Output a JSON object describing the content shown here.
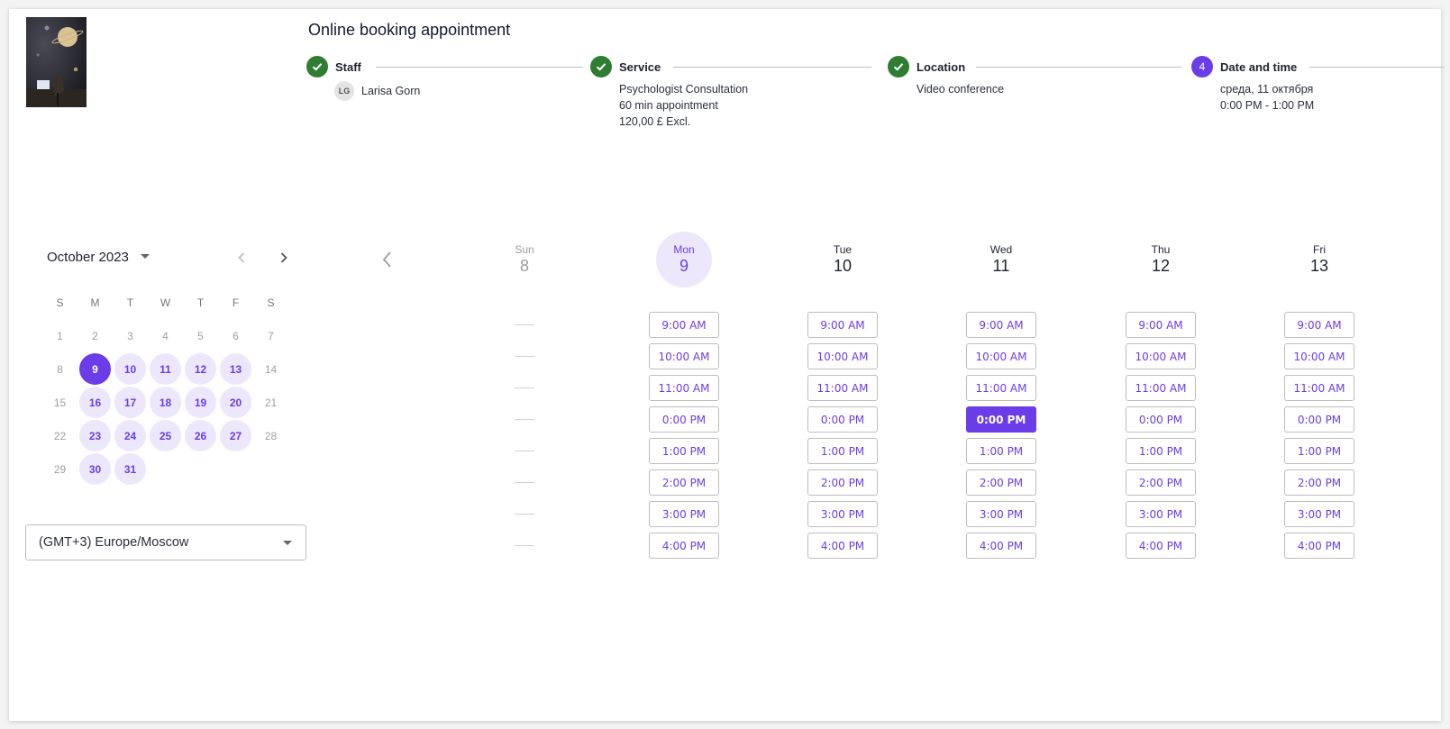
{
  "header": {
    "title": "Online booking appointment",
    "logo_alt": "space-themed logo image"
  },
  "stepper": [
    {
      "label": "Staff",
      "status": "done",
      "icon": "check-icon",
      "staff_initials": "LG",
      "details": [
        "Larisa Gorn"
      ]
    },
    {
      "label": "Service",
      "status": "done",
      "icon": "check-icon",
      "details": [
        "Psychologist Consultation",
        "60 min appointment",
        "120,00 £ Excl."
      ]
    },
    {
      "label": "Location",
      "status": "done",
      "icon": "check-icon",
      "details": [
        "Video conference"
      ]
    },
    {
      "label": "Date and time",
      "status": "active",
      "number": "4",
      "details": [
        "среда, 11 октября",
        "0:00 PM - 1:00 PM"
      ]
    }
  ],
  "calendar": {
    "month_label": "October 2023",
    "weekdays": [
      "S",
      "M",
      "T",
      "W",
      "T",
      "F",
      "S"
    ],
    "days": [
      {
        "n": "1",
        "state": "disabled"
      },
      {
        "n": "2",
        "state": "disabled"
      },
      {
        "n": "3",
        "state": "disabled"
      },
      {
        "n": "4",
        "state": "disabled"
      },
      {
        "n": "5",
        "state": "disabled"
      },
      {
        "n": "6",
        "state": "disabled"
      },
      {
        "n": "7",
        "state": "disabled"
      },
      {
        "n": "8",
        "state": "disabled"
      },
      {
        "n": "9",
        "state": "selected"
      },
      {
        "n": "10",
        "state": "available"
      },
      {
        "n": "11",
        "state": "available"
      },
      {
        "n": "12",
        "state": "available"
      },
      {
        "n": "13",
        "state": "available"
      },
      {
        "n": "14",
        "state": "disabled"
      },
      {
        "n": "15",
        "state": "disabled"
      },
      {
        "n": "16",
        "state": "available"
      },
      {
        "n": "17",
        "state": "available"
      },
      {
        "n": "18",
        "state": "available"
      },
      {
        "n": "19",
        "state": "available"
      },
      {
        "n": "20",
        "state": "available"
      },
      {
        "n": "21",
        "state": "disabled"
      },
      {
        "n": "22",
        "state": "disabled"
      },
      {
        "n": "23",
        "state": "available"
      },
      {
        "n": "24",
        "state": "available"
      },
      {
        "n": "25",
        "state": "available"
      },
      {
        "n": "26",
        "state": "available"
      },
      {
        "n": "27",
        "state": "available"
      },
      {
        "n": "28",
        "state": "disabled"
      },
      {
        "n": "29",
        "state": "disabled"
      },
      {
        "n": "30",
        "state": "available"
      },
      {
        "n": "31",
        "state": "available"
      }
    ]
  },
  "timezone": {
    "value": "(GMT+3) Europe/Moscow"
  },
  "week": {
    "days": [
      {
        "name": "Sun",
        "num": "8",
        "state": "past",
        "slots": []
      },
      {
        "name": "Mon",
        "num": "9",
        "state": "today",
        "slots": [
          "9:00 AM",
          "10:00 AM",
          "11:00 AM",
          "0:00 PM",
          "1:00 PM",
          "2:00 PM",
          "3:00 PM",
          "4:00 PM"
        ]
      },
      {
        "name": "Tue",
        "num": "10",
        "state": "normal",
        "slots": [
          "9:00 AM",
          "10:00 AM",
          "11:00 AM",
          "0:00 PM",
          "1:00 PM",
          "2:00 PM",
          "3:00 PM",
          "4:00 PM"
        ]
      },
      {
        "name": "Wed",
        "num": "11",
        "state": "normal",
        "selected_slot": "0:00 PM",
        "slots": [
          "9:00 AM",
          "10:00 AM",
          "11:00 AM",
          "0:00 PM",
          "1:00 PM",
          "2:00 PM",
          "3:00 PM",
          "4:00 PM"
        ]
      },
      {
        "name": "Thu",
        "num": "12",
        "state": "normal",
        "slots": [
          "9:00 AM",
          "10:00 AM",
          "11:00 AM",
          "0:00 PM",
          "1:00 PM",
          "2:00 PM",
          "3:00 PM",
          "4:00 PM"
        ]
      },
      {
        "name": "Fri",
        "num": "13",
        "state": "normal",
        "slots": [
          "9:00 AM",
          "10:00 AM",
          "11:00 AM",
          "0:00 PM",
          "1:00 PM",
          "2:00 PM",
          "3:00 PM",
          "4:00 PM"
        ]
      }
    ],
    "empty_slot_count": 8
  },
  "colors": {
    "accent": "#6a3de8",
    "accent_light": "#ede7fb",
    "done_green": "#2e7d32"
  }
}
